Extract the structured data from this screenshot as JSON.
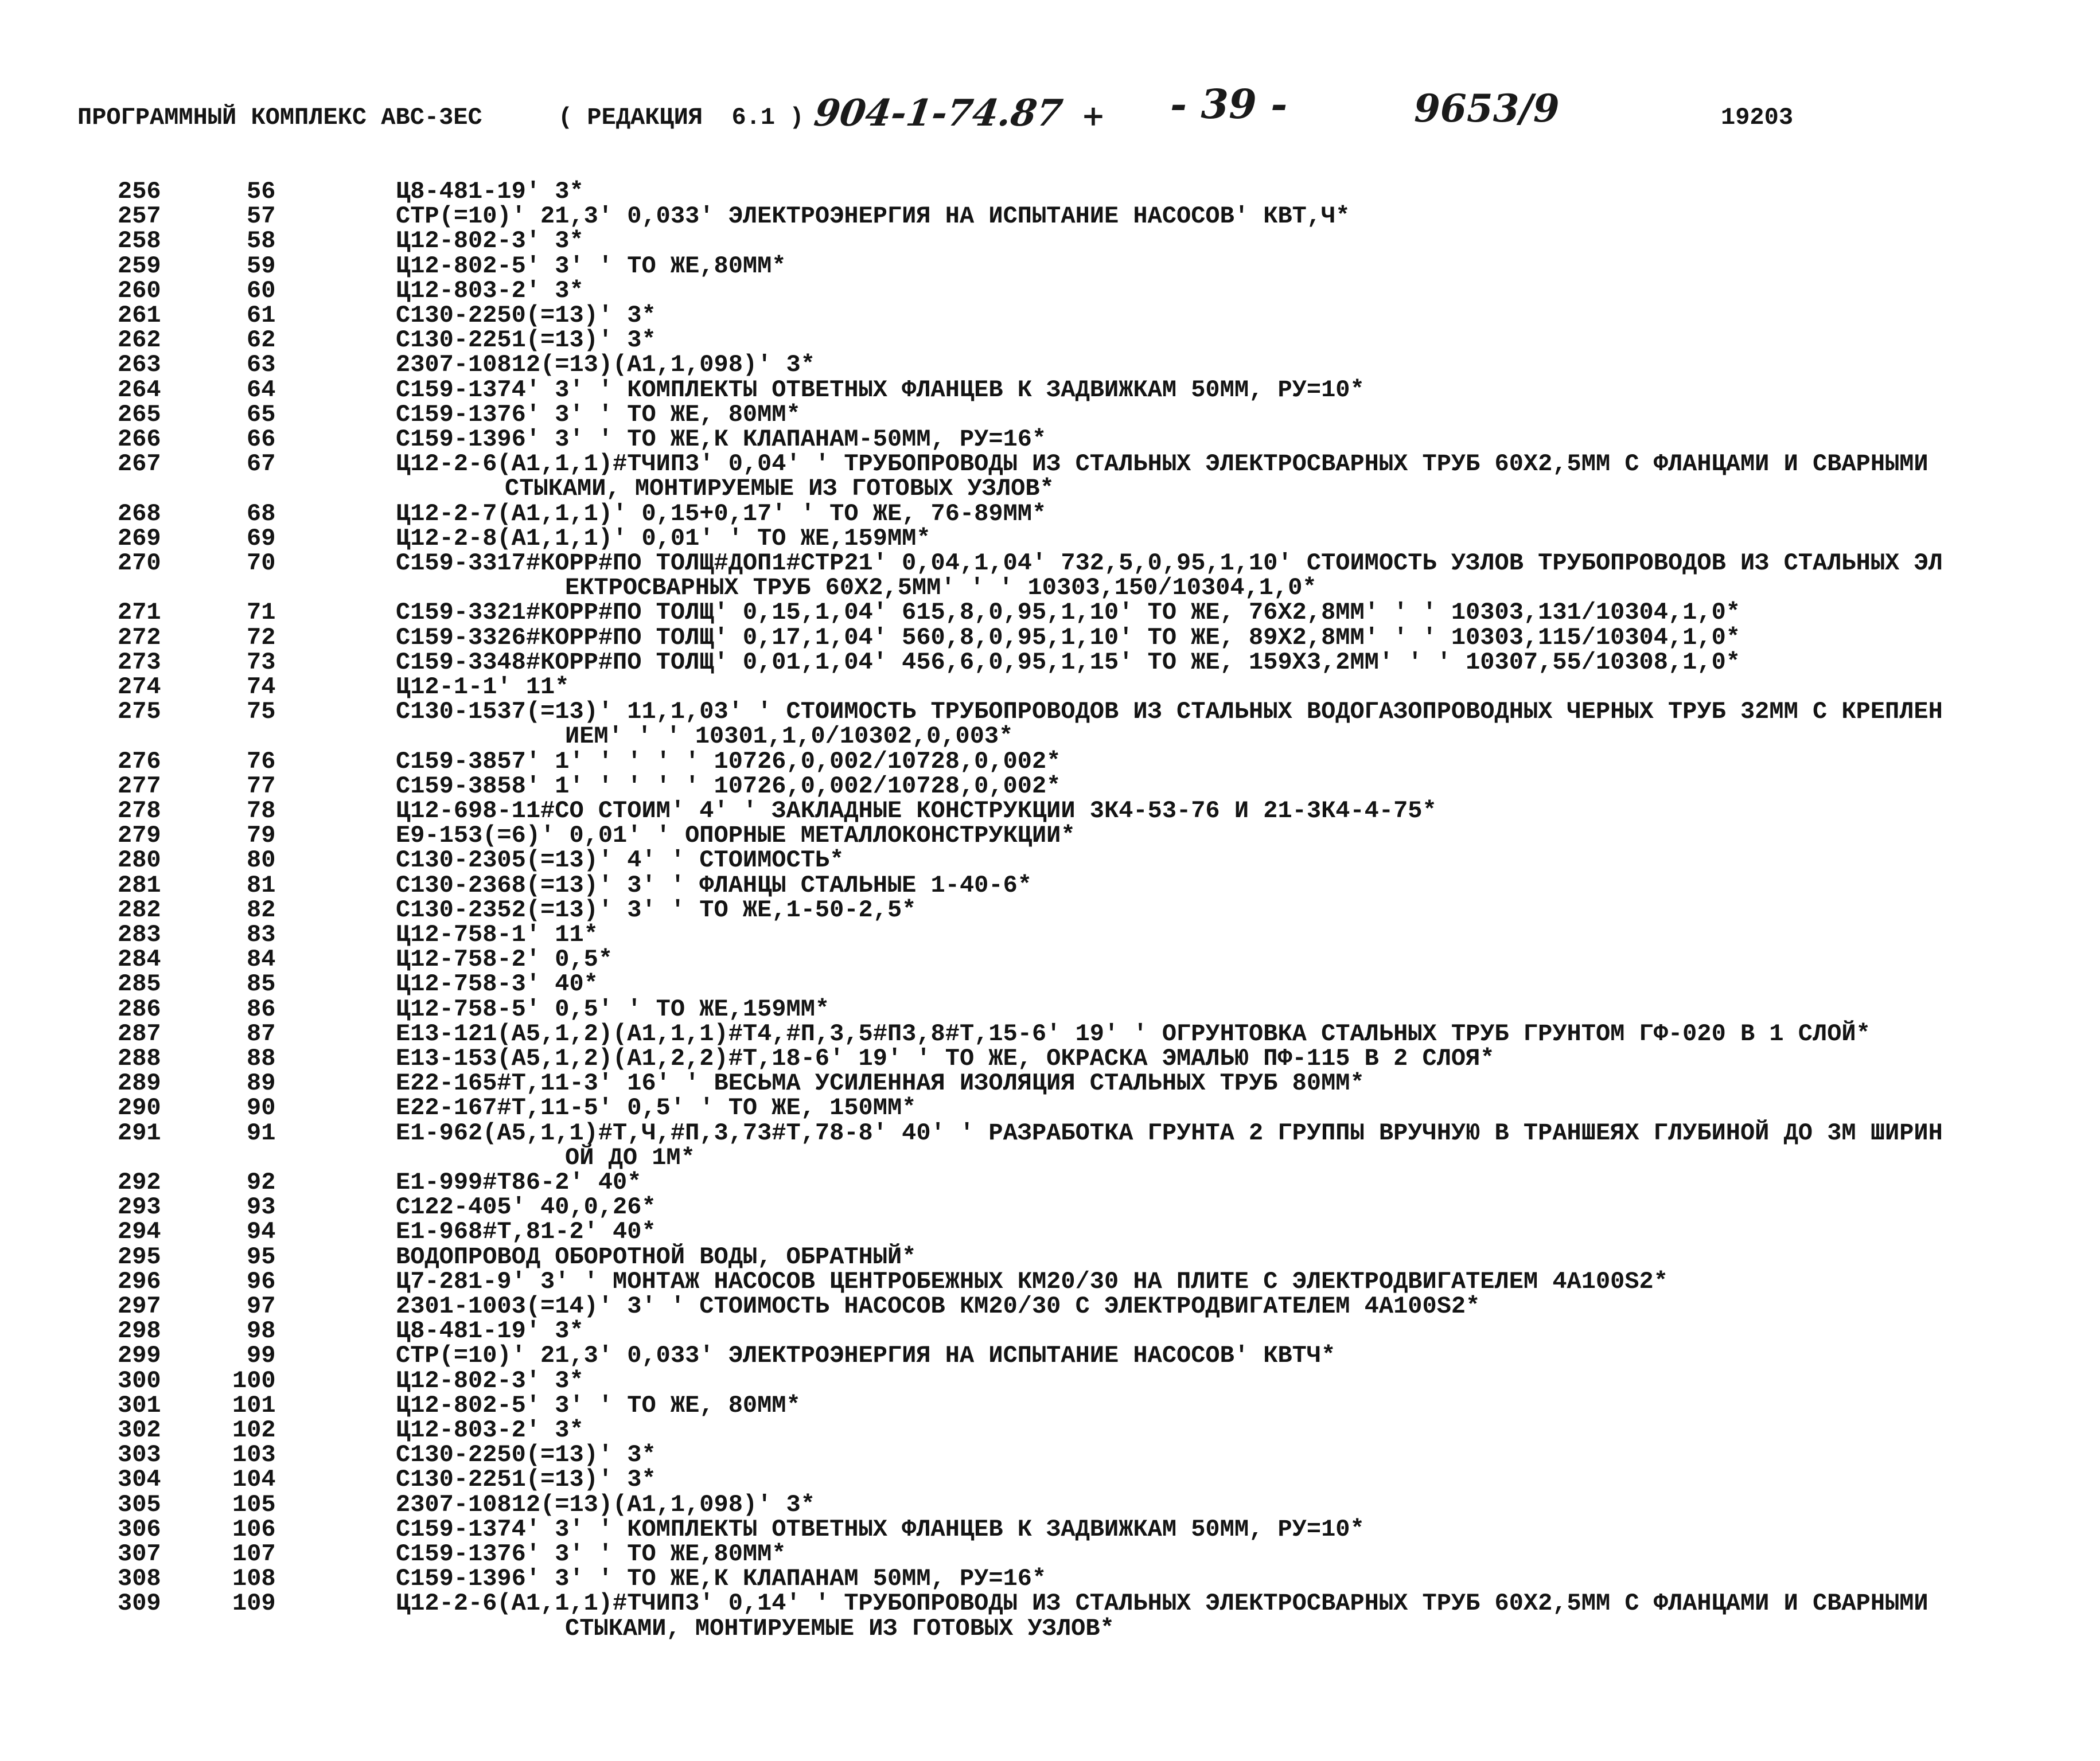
{
  "header": {
    "title": "ПРОГРАММНЫЙ КОМПЛЕКС АВС-3ЕС",
    "edition": "( РЕДАКЦИЯ  6.1 )",
    "handwritten_code": "904-1-74.87",
    "plus_mark": "+",
    "page_number": "- 39 -",
    "handwritten_doc": "9653/9",
    "listing_number": "19203"
  },
  "entries": [
    {
      "n1": "256",
      "n2": "56",
      "lines": [
        "Ц8-481-19' 3*"
      ]
    },
    {
      "n1": "257",
      "n2": "57",
      "lines": [
        "СТР(=10)' 21,3' 0,033' ЭЛЕКТРОЭНЕРГИЯ НА ИСПЫТАНИЕ НАСОСОВ' КВТ,Ч*"
      ]
    },
    {
      "n1": "258",
      "n2": "58",
      "lines": [
        "Ц12-802-3' 3*"
      ]
    },
    {
      "n1": "259",
      "n2": "59",
      "lines": [
        "Ц12-802-5' 3' ' ТО ЖЕ,80ММ*"
      ]
    },
    {
      "n1": "260",
      "n2": "60",
      "lines": [
        "Ц12-803-2' 3*"
      ]
    },
    {
      "n1": "261",
      "n2": "61",
      "lines": [
        "С130-2250(=13)' 3*"
      ]
    },
    {
      "n1": "262",
      "n2": "62",
      "lines": [
        "С130-2251(=13)' 3*"
      ]
    },
    {
      "n1": "263",
      "n2": "63",
      "lines": [
        "2307-10812(=13)(А1,1,098)' 3*"
      ]
    },
    {
      "n1": "264",
      "n2": "64",
      "lines": [
        "С159-1374' 3' ' КОМПЛЕКТЫ ОТВЕТНЫХ ФЛАНЦЕВ К ЗАДВИЖКАМ 50ММ, РУ=10*"
      ]
    },
    {
      "n1": "265",
      "n2": "65",
      "lines": [
        "С159-1376' 3' ' ТО ЖЕ, 80ММ*"
      ]
    },
    {
      "n1": "266",
      "n2": "66",
      "lines": [
        "С159-1396' 3' ' ТО ЖЕ,К КЛАПАНАМ-50ММ, РУ=16*"
      ]
    },
    {
      "n1": "267",
      "n2": "67",
      "lines": [
        "Ц12-2-6(А1,1,1)#ТЧИП3' 0,04' ' ТРУБОПРОВОДЫ ИЗ СТАЛЬНЫХ ЭЛЕКТРОСВАРНЫХ ТРУБ 60Х2,5ММ С ФЛАНЦАМИ И СВАРНЫМИ",
        "СТЫКАМИ, МОНТИРУЕМЫЕ ИЗ ГОТОВЫХ УЗЛОВ*"
      ]
    },
    {
      "n1": "268",
      "n2": "68",
      "lines": [
        "Ц12-2-7(А1,1,1)' 0,15+0,17' ' ТО ЖЕ, 76-89ММ*"
      ]
    },
    {
      "n1": "269",
      "n2": "69",
      "lines": [
        "Ц12-2-8(А1,1,1)' 0,01' ' ТО ЖЕ,159ММ*"
      ]
    },
    {
      "n1": "270",
      "n2": "70",
      "lines": [
        "С159-3317#КОРР#ПО ТОЛЩ#ДОП1#СТР21' 0,04,1,04' 732,5,0,95,1,10' СТОИМОСТЬ УЗЛОВ ТРУБОПРОВОДОВ ИЗ СТАЛЬНЫХ ЭЛ",
        "ЕКТРОСВАРНЫХ ТРУБ 60Х2,5ММ' ' ' 10303,150/10304,1,0*"
      ]
    },
    {
      "n1": "271",
      "n2": "71",
      "lines": [
        "С159-3321#КОРР#ПО ТОЛЩ' 0,15,1,04' 615,8,0,95,1,10' ТО ЖЕ, 76Х2,8ММ' ' ' 10303,131/10304,1,0*"
      ]
    },
    {
      "n1": "272",
      "n2": "72",
      "lines": [
        "С159-3326#КОРР#ПО ТОЛЩ' 0,17,1,04' 560,8,0,95,1,10' ТО ЖЕ, 89Х2,8ММ' ' ' 10303,115/10304,1,0*"
      ]
    },
    {
      "n1": "273",
      "n2": "73",
      "lines": [
        "С159-3348#КОРР#ПО ТОЛЩ' 0,01,1,04' 456,6,0,95,1,15' ТО ЖЕ, 159Х3,2ММ' ' ' 10307,55/10308,1,0*"
      ]
    },
    {
      "n1": "274",
      "n2": "74",
      "lines": [
        "Ц12-1-1' 11*"
      ]
    },
    {
      "n1": "275",
      "n2": "75",
      "lines": [
        "С130-1537(=13)' 11,1,03' ' СТОИМОСТЬ ТРУБОПРОВОДОВ ИЗ СТАЛЬНЫХ ВОДОГАЗОПРОВОДНЫХ ЧЕРНЫХ ТРУБ 32ММ С КРЕПЛЕН",
        "ИЕМ' ' ' 10301,1,0/10302,0,003*"
      ]
    },
    {
      "n1": "276",
      "n2": "76",
      "lines": [
        "С159-3857' 1' ' ' ' ' 10726,0,002/10728,0,002*"
      ]
    },
    {
      "n1": "277",
      "n2": "77",
      "lines": [
        "С159-3858' 1' ' ' ' ' 10726,0,002/10728,0,002*"
      ]
    },
    {
      "n1": "278",
      "n2": "78",
      "lines": [
        "Ц12-698-11#СО СТОИМ' 4' ' ЗАКЛАДНЫЕ КОНСТРУКЦИИ 3К4-53-76 И 21-3К4-4-75*"
      ]
    },
    {
      "n1": "279",
      "n2": "79",
      "lines": [
        "Е9-153(=6)' 0,01' ' ОПОРНЫЕ МЕТАЛЛОКОНСТРУКЦИИ*"
      ]
    },
    {
      "n1": "280",
      "n2": "80",
      "lines": [
        "С130-2305(=13)' 4' ' СТОИМОСТЬ*"
      ]
    },
    {
      "n1": "281",
      "n2": "81",
      "lines": [
        "С130-2368(=13)' 3' ' ФЛАНЦЫ СТАЛЬНЫЕ 1-40-6*"
      ]
    },
    {
      "n1": "282",
      "n2": "82",
      "lines": [
        "С130-2352(=13)' 3' ' ТО ЖЕ,1-50-2,5*"
      ]
    },
    {
      "n1": "283",
      "n2": "83",
      "lines": [
        "Ц12-758-1' 11*"
      ]
    },
    {
      "n1": "284",
      "n2": "84",
      "lines": [
        "Ц12-758-2' 0,5*"
      ]
    },
    {
      "n1": "285",
      "n2": "85",
      "lines": [
        "Ц12-758-3' 40*"
      ]
    },
    {
      "n1": "286",
      "n2": "86",
      "lines": [
        "Ц12-758-5' 0,5' ' ТО ЖЕ,159ММ*"
      ]
    },
    {
      "n1": "287",
      "n2": "87",
      "lines": [
        "Е13-121(А5,1,2)(А1,1,1)#Т4,#П,3,5#П3,8#Т,15-6' 19' ' ОГРУНТОВКА СТАЛЬНЫХ ТРУБ ГРУНТОМ ГФ-020 В 1 СЛОЙ*"
      ]
    },
    {
      "n1": "288",
      "n2": "88",
      "lines": [
        "Е13-153(А5,1,2)(А1,2,2)#Т,18-6' 19' ' ТО ЖЕ, ОКРАСКА ЭМАЛЬЮ ПФ-115 В 2 СЛОЯ*"
      ]
    },
    {
      "n1": "289",
      "n2": "89",
      "lines": [
        "Е22-165#Т,11-3' 16' ' ВЕСЬМА УСИЛЕННАЯ ИЗОЛЯЦИЯ СТАЛЬНЫХ ТРУБ 80ММ*"
      ]
    },
    {
      "n1": "290",
      "n2": "90",
      "lines": [
        "Е22-167#Т,11-5' 0,5' ' ТО ЖЕ, 150ММ*"
      ]
    },
    {
      "n1": "291",
      "n2": "91",
      "lines": [
        "Е1-962(А5,1,1)#Т,Ч,#П,3,73#Т,78-8' 40' ' РАЗРАБОТКА ГРУНТА 2 ГРУППЫ ВРУЧНУЮ В ТРАНШЕЯХ ГЛУБИНОЙ ДО 3М ШИРИН",
        "ОЙ ДО 1М*"
      ]
    },
    {
      "n1": "292",
      "n2": "92",
      "lines": [
        "Е1-999#Т86-2' 40*"
      ]
    },
    {
      "n1": "293",
      "n2": "93",
      "lines": [
        "С122-405' 40,0,26*"
      ]
    },
    {
      "n1": "294",
      "n2": "94",
      "lines": [
        "Е1-968#Т,81-2' 40*"
      ]
    },
    {
      "n1": "295",
      "n2": "95",
      "lines": [
        "ВОДОПРОВОД ОБОРОТНОЙ ВОДЫ, ОБРАТНЫЙ*"
      ]
    },
    {
      "n1": "296",
      "n2": "96",
      "lines": [
        "Ц7-281-9' 3' ' МОНТАЖ НАСОСОВ ЦЕНТРОБЕЖНЫХ КМ20/30 НА ПЛИТЕ С ЭЛЕКТРОДВИГАТЕЛЕМ 4А100S2*"
      ]
    },
    {
      "n1": "297",
      "n2": "97",
      "lines": [
        "2301-1003(=14)' 3' ' СТОИМОСТЬ НАСОСОВ КМ20/30 С ЭЛЕКТРОДВИГАТЕЛЕМ 4А100S2*"
      ]
    },
    {
      "n1": "298",
      "n2": "98",
      "lines": [
        "Ц8-481-19' 3*"
      ]
    },
    {
      "n1": "299",
      "n2": "99",
      "lines": [
        "СТР(=10)' 21,3' 0,033' ЭЛЕКТРОЭНЕРГИЯ НА ИСПЫТАНИЕ НАСОСОВ' КВТЧ*"
      ]
    },
    {
      "n1": "300",
      "n2": "100",
      "lines": [
        "Ц12-802-3' 3*"
      ]
    },
    {
      "n1": "301",
      "n2": "101",
      "lines": [
        "Ц12-802-5' 3' ' ТО ЖЕ, 80ММ*"
      ]
    },
    {
      "n1": "302",
      "n2": "102",
      "lines": [
        "Ц12-803-2' 3*"
      ]
    },
    {
      "n1": "303",
      "n2": "103",
      "lines": [
        "С130-2250(=13)' 3*"
      ]
    },
    {
      "n1": "304",
      "n2": "104",
      "lines": [
        "С130-2251(=13)' 3*"
      ]
    },
    {
      "n1": "305",
      "n2": "105",
      "lines": [
        "2307-10812(=13)(А1,1,098)' 3*"
      ]
    },
    {
      "n1": "306",
      "n2": "106",
      "lines": [
        "С159-1374' 3' ' КОМПЛЕКТЫ ОТВЕТНЫХ ФЛАНЦЕВ К ЗАДВИЖКАМ 50ММ, РУ=10*"
      ]
    },
    {
      "n1": "307",
      "n2": "107",
      "lines": [
        "С159-1376' 3' ' ТО ЖЕ,80ММ*"
      ]
    },
    {
      "n1": "308",
      "n2": "108",
      "lines": [
        "С159-1396' 3' ' ТО ЖЕ,К КЛАПАНАМ 50ММ, РУ=16*"
      ]
    },
    {
      "n1": "309",
      "n2": "109",
      "lines": [
        "Ц12-2-6(А1,1,1)#ТЧИП3' 0,14' ' ТРУБОПРОВОДЫ ИЗ СТАЛЬНЫХ ЭЛЕКТРОСВАРНЫХ ТРУБ 60Х2,5ММ С ФЛАНЦАМИ И СВАРНЫМИ",
        "СТЫКАМИ, МОНТИРУЕМЫЕ ИЗ ГОТОВЫХ УЗЛОВ*"
      ]
    }
  ]
}
